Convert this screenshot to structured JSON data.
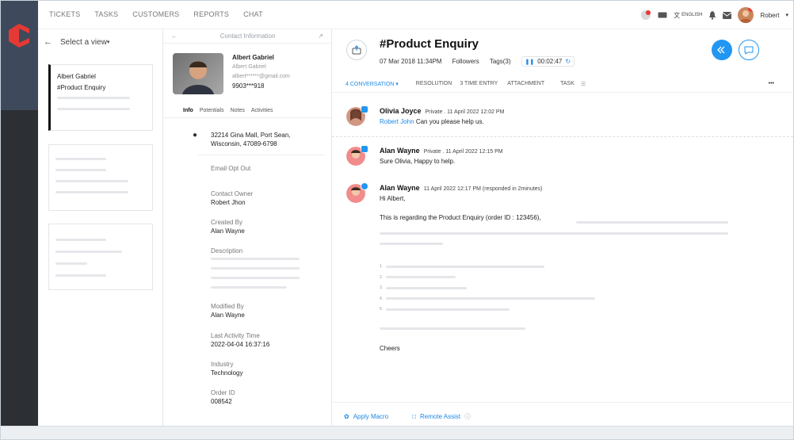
{
  "nav": [
    "TICKETS",
    "TASKS",
    "CUSTOMERS",
    "REPORTS",
    "CHAT"
  ],
  "top_right": {
    "lang": "ENGLISH",
    "user": "Robert",
    "badge": "4"
  },
  "left": {
    "select_view": "Select a view",
    "card": {
      "name": "Albert Gabriel",
      "subject": "#Product Enquiry"
    }
  },
  "contact": {
    "header": "Contact Information",
    "name": "Albert Gabriel",
    "alt_name": "Albert Gabriel",
    "email": "albert******@gmail.com",
    "phone": "9903***918",
    "tabs": [
      "Info",
      "Potentials",
      "Notes",
      "Activities"
    ],
    "address": "32214 Gina Mall, Port Sean, Wisconsin, 47089-6798",
    "email_opt_out": "Email Opt Out",
    "fields": [
      {
        "k": "Contact Owner",
        "v": "Robert Jhon"
      },
      {
        "k": "Created By",
        "v": "Alan Wayne"
      },
      {
        "k": "Description",
        "v": ""
      },
      {
        "k": "Modified By",
        "v": "Alan Wayne"
      },
      {
        "k": "Last Activity Time",
        "v": "2022-04-04 16:37:16"
      },
      {
        "k": "Industry",
        "v": "Technology"
      },
      {
        "k": "Order ID",
        "v": "008542"
      }
    ]
  },
  "ticket": {
    "title": "#Product Enquiry",
    "date": "07 Mar 2018 11:34PM",
    "followers": "Followers",
    "tags": "Tags(3)",
    "timer": "00:02:47",
    "tabs": [
      "4 CONVERSATION",
      "RESOLUTION",
      "3 TIME ENTRY",
      "ATTACHMENT",
      "TASK"
    ]
  },
  "messages": [
    {
      "name": "Olivia Joyce",
      "meta": "Private . 11 April 2022  12:02 PM",
      "mention": "Robert John",
      "text": "Can you please help us."
    },
    {
      "name": "Alan Wayne",
      "meta": "Private . 11 April 2022  12:15 PM",
      "text": "Sure Olivia, Happy to help."
    },
    {
      "name": "Alan Wayne",
      "meta": "11 April 2022  12:17 PM  (responded in 2minutes)",
      "greeting": "Hi Albert,",
      "body": "This is regarding the Product Enquiry (order ID : 123456),",
      "list": [
        "1.",
        "2.",
        "3.",
        "4.",
        "5."
      ],
      "sign": "Cheers"
    }
  ],
  "footer": {
    "macro": "Apply Macro",
    "remote": "Remote Assist"
  },
  "colors": {
    "accent": "#1e88e5",
    "rail": "#2c2f33",
    "logo": "#e53935"
  }
}
